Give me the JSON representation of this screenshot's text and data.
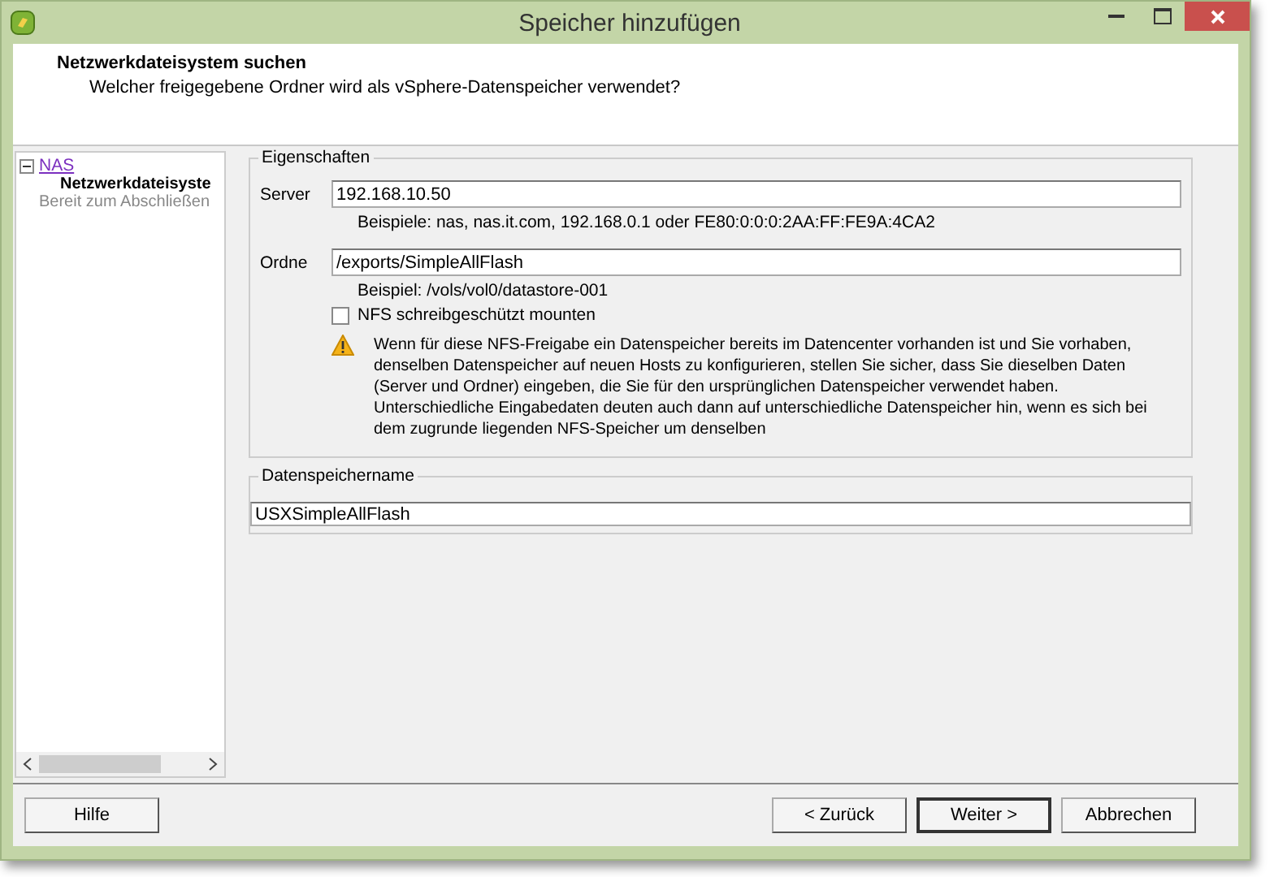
{
  "window": {
    "title": "Speicher hinzufügen"
  },
  "header": {
    "title": "Netzwerkdateisystem suchen",
    "subtitle": "Welcher freigegebene Ordner wird als vSphere-Datenspeicher verwendet?"
  },
  "sidebar": {
    "items": [
      {
        "label": "NAS",
        "expanded": true,
        "children": [
          {
            "label": "Netzwerkdateisyste",
            "selected": true
          },
          {
            "label": "Bereit zum Abschließen",
            "selected": false
          }
        ]
      }
    ]
  },
  "properties": {
    "legend": "Eigenschaften",
    "server": {
      "label": "Server",
      "value": "192.168.10.50",
      "hint": "Beispiele: nas, nas.it.com, 192.168.0.1 oder FE80:0:0:0:2AA:FF:FE9A:4CA2"
    },
    "folder": {
      "label": "Ordne",
      "value": "/exports/SimpleAllFlash",
      "hint": "Beispiel: /vols/vol0/datastore-001"
    },
    "readonly": {
      "label": "NFS schreibgeschützt mounten",
      "checked": false
    },
    "warning": "Wenn für diese NFS-Freigabe ein Datenspeicher bereits im Datencenter vorhanden ist und Sie vorhaben, denselben Datenspeicher auf neuen Hosts zu konfigurieren, stellen Sie sicher, dass Sie dieselben Daten (Server und Ordner) eingeben, die Sie für den ursprünglichen Datenspeicher verwendet haben. Unterschiedliche Eingabedaten deuten auch dann auf unterschiedliche Datenspeicher hin, wenn es sich bei dem zugrunde liegenden NFS-Speicher um denselben"
  },
  "datastore": {
    "legend": "Datenspeichername",
    "value": "USXSimpleAllFlash"
  },
  "buttons": [
    {
      "label": "Hilfe",
      "default": false
    },
    {
      "label": "< Zurück",
      "default": false
    },
    {
      "label": "Weiter >",
      "default": true
    },
    {
      "label": "Abbrechen",
      "default": false
    }
  ]
}
